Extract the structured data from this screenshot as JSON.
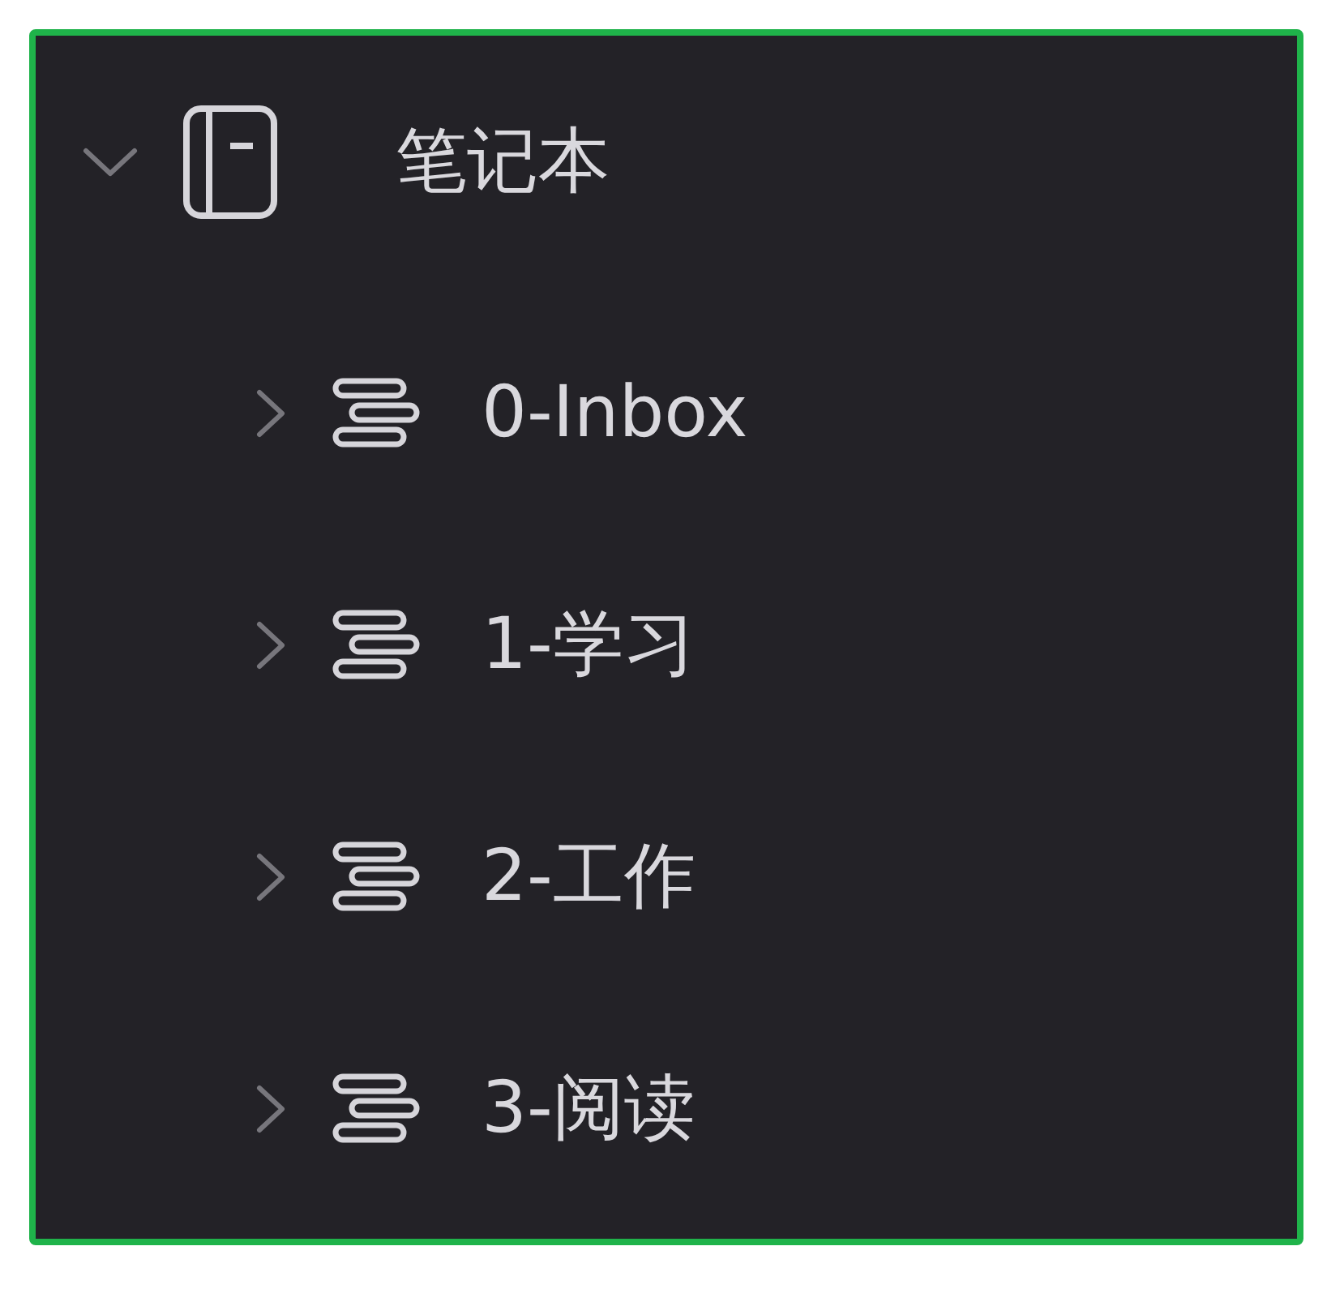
{
  "tree": [
    {
      "label": "笔记本",
      "expanded": true,
      "children": [
        {
          "label": "0-Inbox",
          "expanded": false
        },
        {
          "label": "1-学习",
          "expanded": false
        },
        {
          "label": "2-工作",
          "expanded": false
        },
        {
          "label": "3-阅读",
          "expanded": false
        }
      ]
    }
  ]
}
